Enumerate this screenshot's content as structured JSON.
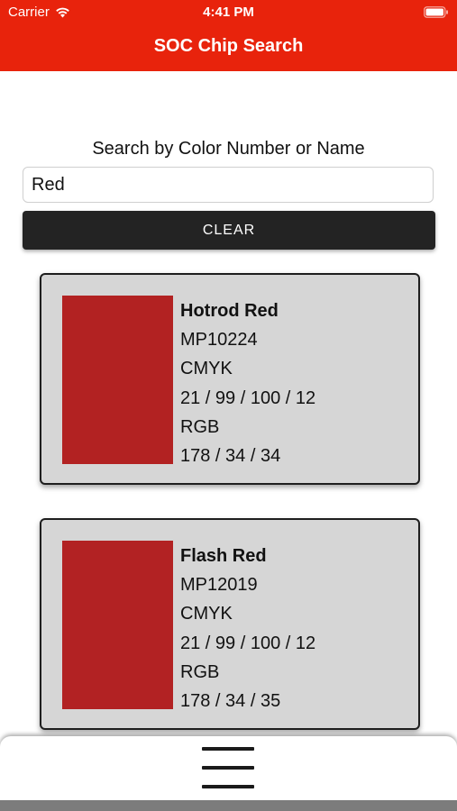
{
  "status_bar": {
    "carrier": "Carrier",
    "time": "4:41 PM",
    "wifi_icon": "wifi-icon",
    "battery_icon": "battery-icon"
  },
  "header": {
    "title": "SOC Chip Search",
    "background_color": "#e8230c"
  },
  "search": {
    "label": "Search by Color Number or Name",
    "value": "Red",
    "clear_label": "CLEAR"
  },
  "results": [
    {
      "name": "Hotrod Red",
      "code": "MP10224",
      "cmyk_label": "CMYK",
      "cmyk": "21 / 99 / 100 / 12",
      "rgb_label": "RGB",
      "rgb": "178 / 34 / 34",
      "swatch_color": "#b22222"
    },
    {
      "name": "Flash Red",
      "code": "MP12019",
      "cmyk_label": "CMYK",
      "cmyk": "21 / 99 / 100 / 12",
      "rgb_label": "RGB",
      "rgb": "178 / 34 / 35",
      "swatch_color": "#b22223"
    }
  ],
  "bottom_bar": {
    "menu_icon": "hamburger-menu-icon"
  }
}
